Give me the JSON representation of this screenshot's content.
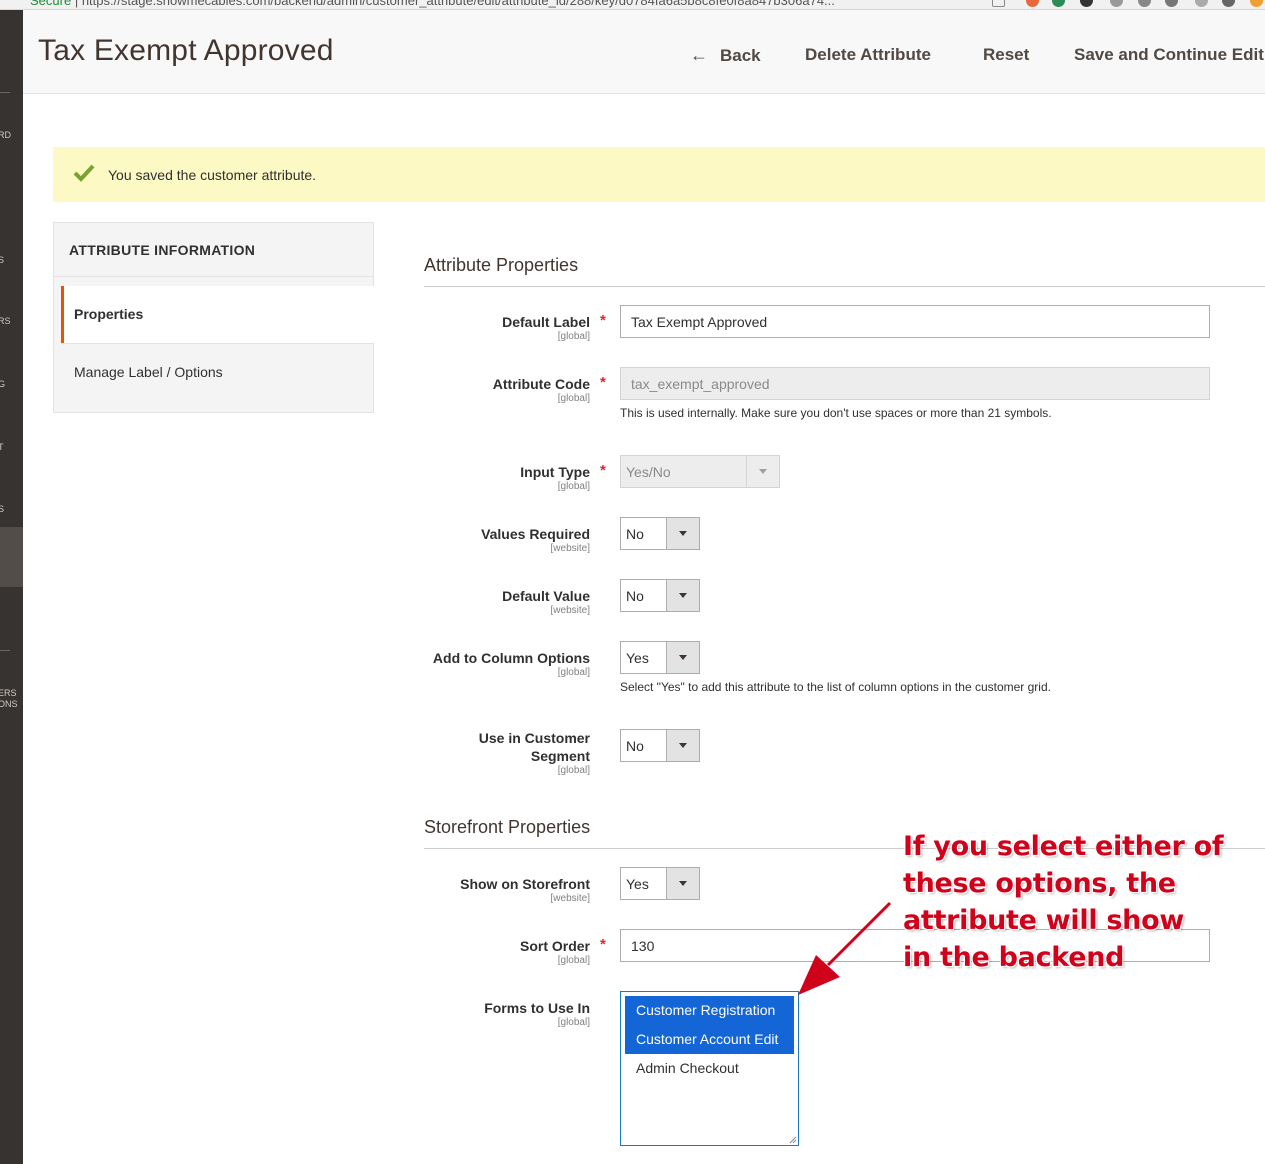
{
  "browser": {
    "secure_label": "Secure",
    "url": "https://stage.showmecables.com/backend/admin/customer_attribute/edit/attribute_id/288/key/d0784fa6a5b8c8fe0f8a847b306a74..."
  },
  "sidebar": {
    "items": [
      "RD",
      "S",
      "RS",
      "G",
      "T",
      "S",
      "ERS",
      "ONS"
    ]
  },
  "header": {
    "title": "Tax Exempt Approved",
    "back_label": "Back",
    "delete_label": "Delete Attribute",
    "reset_label": "Reset",
    "save_continue_label": "Save and Continue Edit"
  },
  "message": {
    "text": "You saved the customer attribute."
  },
  "tabs": {
    "title": "ATTRIBUTE INFORMATION",
    "items": [
      "Properties",
      "Manage Label / Options"
    ]
  },
  "attribute_properties": {
    "title": "Attribute Properties",
    "default_label": {
      "label": "Default Label",
      "scope": "[global]",
      "value": "Tax Exempt Approved"
    },
    "attribute_code": {
      "label": "Attribute Code",
      "scope": "[global]",
      "value": "tax_exempt_approved",
      "note": "This is used internally. Make sure you don't use spaces or more than 21 symbols."
    },
    "input_type": {
      "label": "Input Type",
      "scope": "[global]",
      "value": "Yes/No"
    },
    "values_required": {
      "label": "Values Required",
      "scope": "[website]",
      "value": "No"
    },
    "default_value": {
      "label": "Default Value",
      "scope": "[website]",
      "value": "No"
    },
    "add_to_column": {
      "label": "Add to Column Options",
      "scope": "[global]",
      "value": "Yes",
      "note": "Select \"Yes\" to add this attribute to the list of column options in the customer grid."
    },
    "customer_segment": {
      "label_line1": "Use in Customer",
      "label_line2": "Segment",
      "scope": "[global]",
      "value": "No"
    }
  },
  "storefront_properties": {
    "title": "Storefront Properties",
    "show_on_storefront": {
      "label": "Show on Storefront",
      "scope": "[website]",
      "value": "Yes"
    },
    "sort_order": {
      "label": "Sort Order",
      "scope": "[global]",
      "value": "130"
    },
    "forms": {
      "label": "Forms to Use In",
      "scope": "[global]",
      "options": [
        "Customer Registration",
        "Customer Account Edit",
        "Admin Checkout"
      ]
    }
  },
  "required_mark": "*",
  "annotation": {
    "lines": [
      "If you select either of",
      "these options, the",
      "attribute will show",
      "in the backend"
    ],
    "color": "#d0021b"
  },
  "colors": {
    "accent": "#eb5202",
    "selected_option": "#1466d6",
    "message_bg": "#fdf9c5",
    "check": "#79a22e"
  }
}
